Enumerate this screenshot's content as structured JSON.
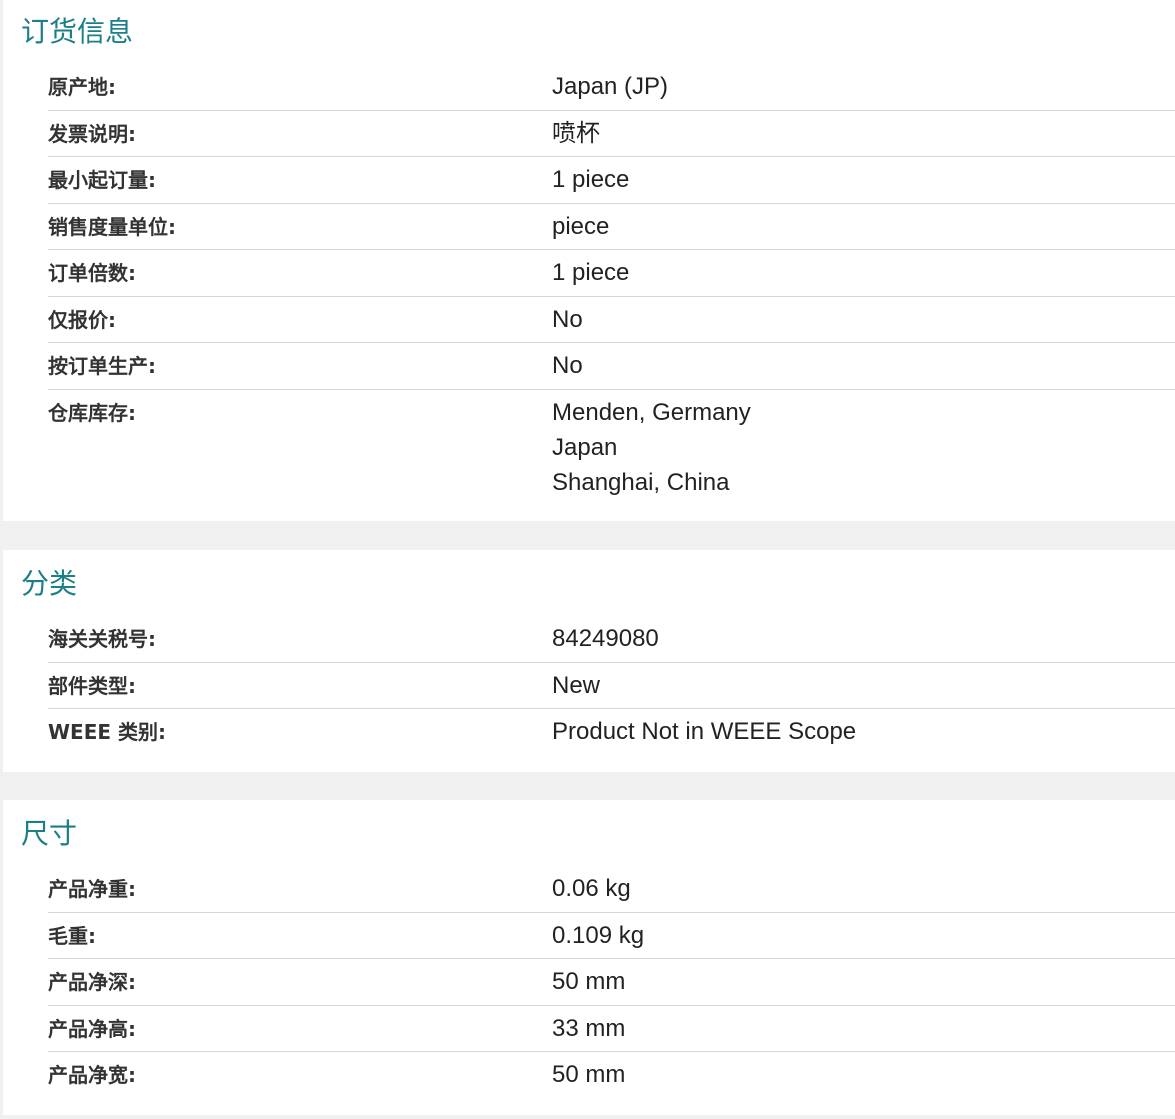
{
  "sections": [
    {
      "title": "订货信息",
      "rows": [
        {
          "label": "原产地:",
          "value": "Japan (JP)"
        },
        {
          "label": "发票说明:",
          "value": "喷杯"
        },
        {
          "label": "最小起订量:",
          "value": "1 piece"
        },
        {
          "label": "销售度量单位:",
          "value": "piece"
        },
        {
          "label": "订单倍数:",
          "value": "1 piece"
        },
        {
          "label": "仅报价:",
          "value": "No"
        },
        {
          "label": "按订单生产:",
          "value": "No"
        },
        {
          "label": "仓库库存:",
          "values": [
            "Menden, Germany",
            "Japan",
            "Shanghai, China"
          ]
        }
      ]
    },
    {
      "title": "分类",
      "rows": [
        {
          "label": "海关关税号:",
          "value": "84249080"
        },
        {
          "label": "部件类型:",
          "value": "New"
        },
        {
          "label": "WEEE 类别:",
          "value": "Product Not in WEEE Scope"
        }
      ]
    },
    {
      "title": "尺寸",
      "rows": [
        {
          "label": "产品净重:",
          "value": "0.06 kg"
        },
        {
          "label": "毛重:",
          "value": "0.109 kg"
        },
        {
          "label": "产品净深:",
          "value": "50 mm"
        },
        {
          "label": "产品净高:",
          "value": "33 mm"
        },
        {
          "label": "产品净宽:",
          "value": "50 mm"
        }
      ]
    }
  ]
}
